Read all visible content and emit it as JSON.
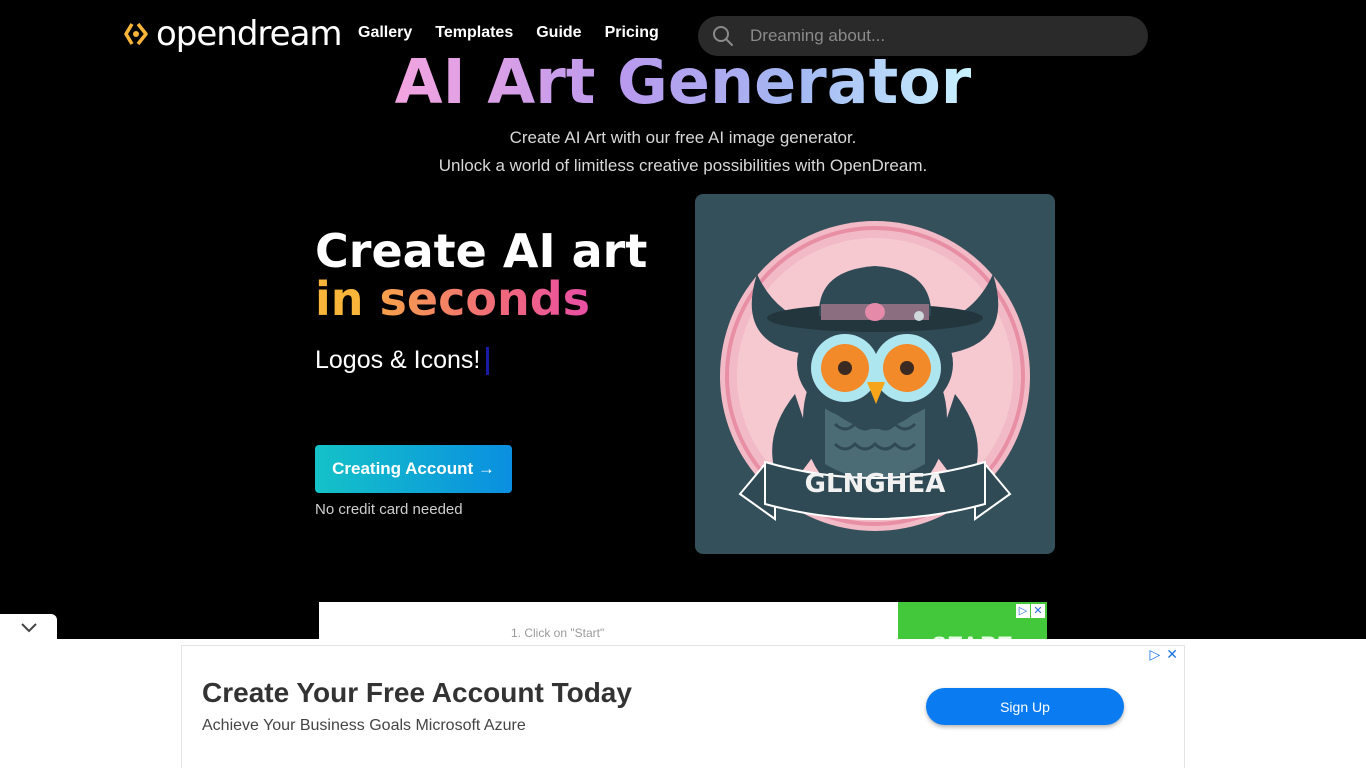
{
  "header": {
    "logo_text": "opendream",
    "nav": [
      "Gallery",
      "Templates",
      "Guide",
      "Pricing"
    ],
    "search_placeholder": "Dreaming about..."
  },
  "hero": {
    "title": "AI Art Generator",
    "subtitle_line1": "Create AI Art with our free AI image generator.",
    "subtitle_line2": "Unlock a world of limitless creative possibilities with OpenDream.",
    "heading_line1": "Create AI art",
    "heading_line2_a": "in ",
    "heading_line2_b": "seconds",
    "typed_text": "Logos & Icons!",
    "cta_label": "Creating Account →",
    "cta_note": "No credit card needed",
    "art_caption": "GLNGHEA"
  },
  "ad_strip": {
    "step_text": "1. Click on \"Start\"",
    "green_text": "START"
  },
  "bottom_ad": {
    "title": "Create Your Free Account Today",
    "subtitle": "Achieve Your Business Goals Microsoft Azure",
    "button": "Sign Up"
  },
  "colors": {
    "accent_orange": "#f8b53a",
    "cta_start": "#14c2c8",
    "cta_end": "#0a8fe0",
    "ad_button": "#0a7bf0"
  }
}
